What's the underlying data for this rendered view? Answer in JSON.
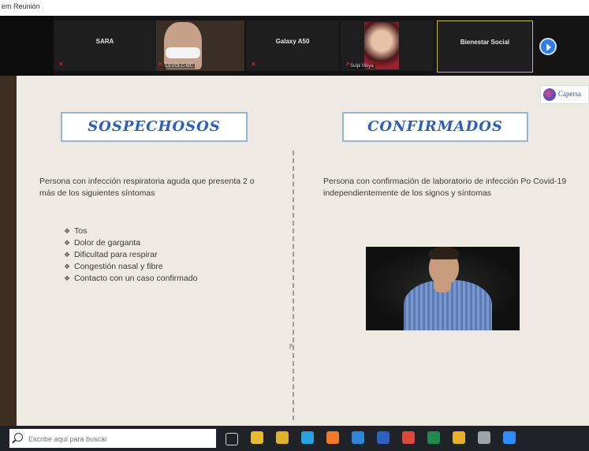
{
  "window": {
    "title": "em Reunión"
  },
  "video_strip": {
    "tiles": [
      {
        "name": "SARA",
        "caption": ""
      },
      {
        "name": "",
        "caption": "LEVOLC-MC"
      },
      {
        "name": "Galaxy A50",
        "caption": ""
      },
      {
        "name": "",
        "caption": "Sulpi Moya"
      },
      {
        "name": "Bienestar Social",
        "caption": ""
      }
    ]
  },
  "slide": {
    "logo_text": "Capersa",
    "left": {
      "title": "SOSPECHOSOS",
      "paragraph": "Persona con infección respiratoria aguda que presenta 2 o más de los siguientes síntomas",
      "bullets": [
        "Tos",
        "Dolor de garganta",
        "Dificultad para respirar",
        "Congestión nasal y fibre",
        "Contacto con un caso confirmado"
      ]
    },
    "right": {
      "title": "CONFIRMADOS",
      "paragraph": "Persona con confirmación de laboratorio de infección Po Covid-19 independientemente de los signos y síntomas"
    }
  },
  "taskbar": {
    "search_placeholder": "Escribe aquí para buscar",
    "icons": [
      {
        "name": "task-view-icon",
        "color": "#cfd3d6"
      },
      {
        "name": "file-explorer-icon",
        "color": "#e8b931"
      },
      {
        "name": "chrome-icon",
        "color": "#e0b030"
      },
      {
        "name": "edge-icon",
        "color": "#2aa1e0"
      },
      {
        "name": "firefox-icon",
        "color": "#f07a2a"
      },
      {
        "name": "store-icon",
        "color": "#2f86d8"
      },
      {
        "name": "word-icon",
        "color": "#2b62c0"
      },
      {
        "name": "app-icon",
        "color": "#d94a3a"
      },
      {
        "name": "excel-icon",
        "color": "#1f8a4c"
      },
      {
        "name": "chrome-alt-icon",
        "color": "#e6b02c"
      },
      {
        "name": "edit-icon",
        "color": "#9da4aa"
      },
      {
        "name": "zoom-icon",
        "color": "#2d8cff"
      }
    ]
  },
  "colors": {
    "title_text": "#2c5fb7",
    "title_border": "#97b6d6",
    "slide_bg": "#efe9e3",
    "frame": "#3d2e21",
    "taskbar": "#1f2327",
    "next_button": "#2f7de1"
  }
}
